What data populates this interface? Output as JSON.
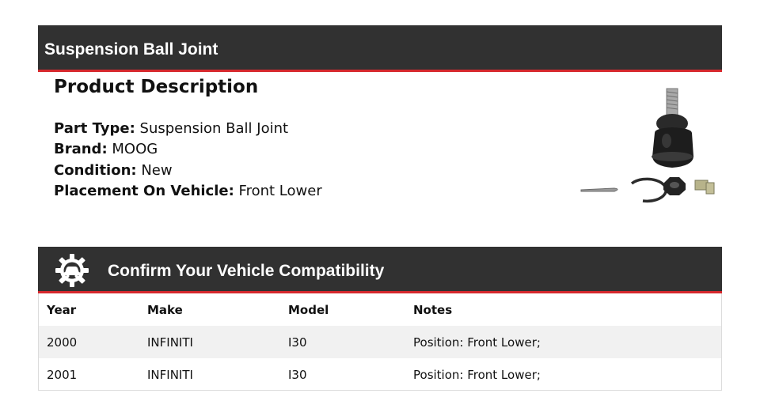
{
  "header": {
    "title": "Suspension Ball Joint"
  },
  "description": {
    "heading": "Product Description",
    "specs": [
      {
        "key": "Part Type:",
        "value": "Suspension Ball Joint"
      },
      {
        "key": "Brand:",
        "value": "MOOG"
      },
      {
        "key": "Condition:",
        "value": "New"
      },
      {
        "key": "Placement On Vehicle:",
        "value": "Front Lower"
      }
    ]
  },
  "compatibility": {
    "title": "Confirm Your Vehicle Compatibility",
    "columns": [
      "Year",
      "Make",
      "Model",
      "Notes"
    ],
    "rows": [
      [
        "2000",
        "INFINITI",
        "I30",
        "Position: Front Lower;"
      ],
      [
        "2001",
        "INFINITI",
        "I30",
        "Position: Front Lower;"
      ]
    ]
  },
  "icons": {
    "compat": "gear-car-icon",
    "product": "ball-joint-image"
  },
  "colors": {
    "bar": "#313131",
    "accent": "#d6282d",
    "alt_row": "#f1f1f1"
  }
}
